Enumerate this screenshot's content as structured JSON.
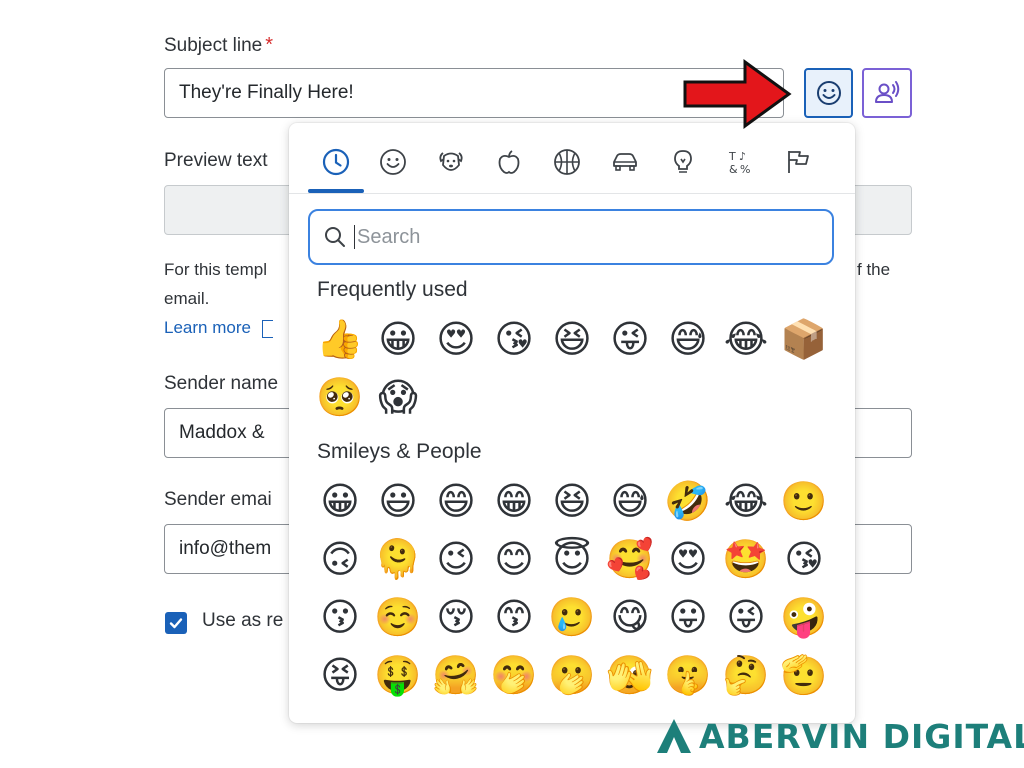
{
  "form": {
    "subject_label": "Subject line",
    "required_mark": "*",
    "subject_value": "They're Finally Here!",
    "preview_label": "Preview text",
    "preview_value": "",
    "helper_line1_start": "For this templ",
    "helper_line1_end": "f the",
    "helper_line2": "email.",
    "learn_more": "Learn more",
    "sender_name_label": "Sender name",
    "sender_name_value": "Maddox &",
    "sender_email_label": "Sender emai",
    "sender_email_value": "info@them",
    "reply_checkbox_label": "Use as re",
    "reply_checked": true
  },
  "toolbar": {
    "emoji_button_icon": "smiley-icon",
    "personalize_button_icon": "person-voice-icon",
    "accent_color": "#1a61b8",
    "personalize_color": "#7b61d6"
  },
  "picker": {
    "categories": [
      {
        "name": "recent",
        "icon": "clock-icon",
        "active": true
      },
      {
        "name": "smileys",
        "icon": "smiley-icon"
      },
      {
        "name": "animals",
        "icon": "dog-icon"
      },
      {
        "name": "food",
        "icon": "apple-icon"
      },
      {
        "name": "activities",
        "icon": "basketball-icon"
      },
      {
        "name": "travel",
        "icon": "car-icon"
      },
      {
        "name": "objects",
        "icon": "lightbulb-icon"
      },
      {
        "name": "symbols",
        "icon": "symbols-icon"
      },
      {
        "name": "flags",
        "icon": "flag-icon"
      }
    ],
    "search_placeholder": "Search",
    "frequently_used_title": "Frequently used",
    "frequently_used": [
      "👍",
      "😀",
      "😍",
      "😘",
      "😆",
      "😜",
      "😅",
      "😂",
      "📦",
      "🥺",
      "😱"
    ],
    "smileys_title": "Smileys & People",
    "smileys": [
      "😀",
      "😃",
      "😄",
      "😁",
      "😆",
      "😅",
      "🤣",
      "😂",
      "🙂",
      "🙃",
      "🫠",
      "😉",
      "😊",
      "😇",
      "🥰",
      "😍",
      "🤩",
      "😘",
      "😗",
      "☺️",
      "😚",
      "😙",
      "🥲",
      "😋",
      "😛",
      "😜",
      "🤪",
      "😝",
      "🤑",
      "🤗",
      "🤭",
      "🫢",
      "🫣",
      "🤫",
      "🤔",
      "🫡"
    ]
  },
  "annotation": {
    "arrow_color": "#e3161b"
  },
  "brand": {
    "name": "ABERVIN DIGITAL",
    "color": "#1d7f7a"
  }
}
